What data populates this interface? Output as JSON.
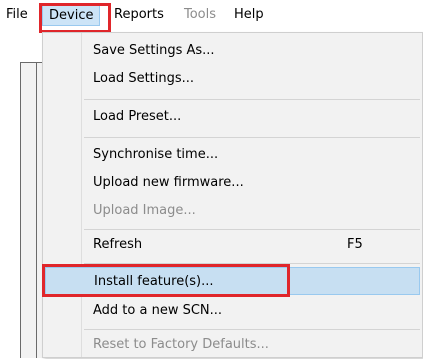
{
  "menubar": {
    "items": [
      {
        "label": "File",
        "state": "normal"
      },
      {
        "label": "Device",
        "state": "active"
      },
      {
        "label": "Reports",
        "state": "normal"
      },
      {
        "label": "Tools",
        "state": "disabled"
      },
      {
        "label": "Help",
        "state": "normal"
      }
    ]
  },
  "device_menu": {
    "save_settings_as": "Save Settings As...",
    "load_settings": "Load Settings...",
    "load_preset": "Load Preset...",
    "synchronise_time": "Synchronise time...",
    "upload_new_firmware": "Upload new firmware...",
    "upload_image": "Upload Image...",
    "refresh": "Refresh",
    "refresh_shortcut": "F5",
    "install_features": "Install feature(s)...",
    "add_to_new_scn": "Add to a new SCN...",
    "reset_to_factory_defaults": "Reset to Factory Defaults..."
  },
  "colors": {
    "annotation_red": "#e0262b",
    "selection_bg": "#c7dff2",
    "selection_border": "#99c9ef",
    "menu_bg": "#f2f2f2",
    "disabled_text": "#8c8c8c"
  }
}
